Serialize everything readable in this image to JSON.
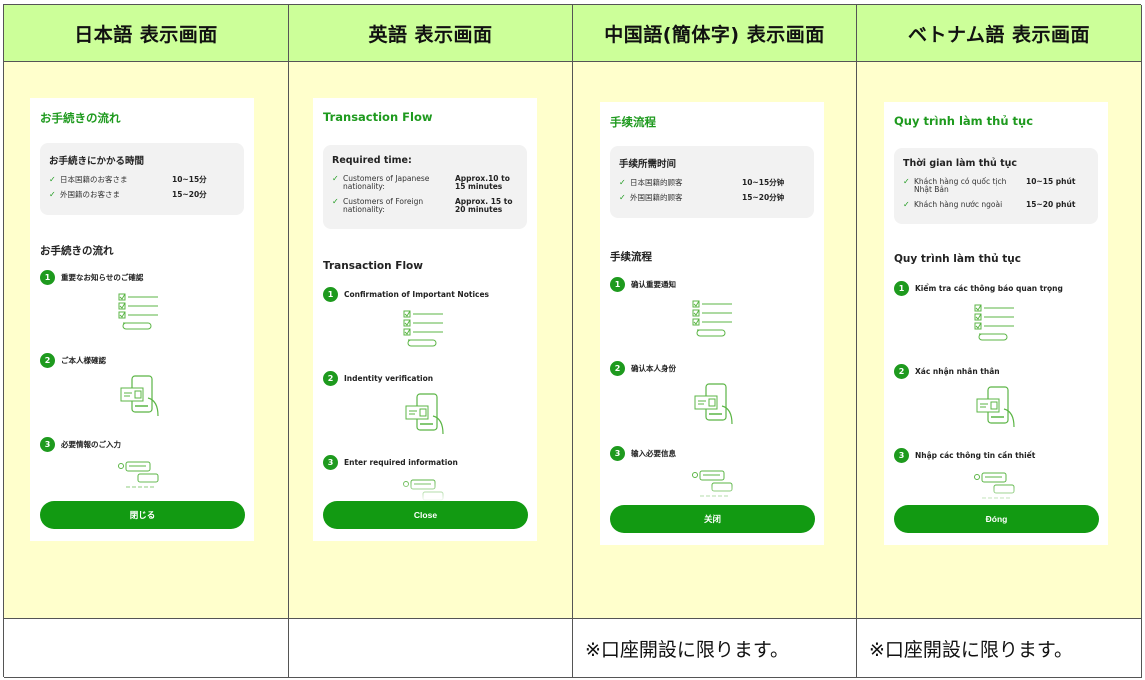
{
  "columns": [
    {
      "header": "日本語 表示画面",
      "footer": "",
      "screen": {
        "title": "お手続きの流れ",
        "required_time_title": "お手続きにかかる時間",
        "rows": [
          {
            "label": "日本国籍のお客さま",
            "value": "10~15分"
          },
          {
            "label": "外国籍のお客さま",
            "value": "15~20分"
          }
        ],
        "flow_title": "お手続きの流れ",
        "steps": [
          {
            "num": "1",
            "label": "重要なお知らせのご確認"
          },
          {
            "num": "2",
            "label": "ご本人様確認"
          },
          {
            "num": "3",
            "label": "必要情報のご入力"
          }
        ],
        "close_label": "閉じる"
      }
    },
    {
      "header": "英語 表示画面",
      "footer": "",
      "screen": {
        "title": "Transaction Flow",
        "required_time_title": "Required time:",
        "rows": [
          {
            "label": "Customers of Japanese nationality:",
            "value": "Approx.10 to 15 minutes"
          },
          {
            "label": "Customers of Foreign nationality:",
            "value": "Approx. 15 to 20 minutes"
          }
        ],
        "flow_title": "Transaction Flow",
        "steps": [
          {
            "num": "1",
            "label": "Confirmation of Important Notices"
          },
          {
            "num": "2",
            "label": "Indentity verification"
          },
          {
            "num": "3",
            "label": "Enter required information"
          }
        ],
        "close_label": "Close"
      }
    },
    {
      "header": "中国語(簡体字) 表示画面",
      "footer": "※口座開設に限ります。",
      "screen": {
        "title": "手续流程",
        "required_time_title": "手续所需时间",
        "rows": [
          {
            "label": "日本国籍的顾客",
            "value": "10~15分钟"
          },
          {
            "label": "外国国籍的顾客",
            "value": "15~20分钟"
          }
        ],
        "flow_title": "手续流程",
        "steps": [
          {
            "num": "1",
            "label": "确认重要通知"
          },
          {
            "num": "2",
            "label": "确认本人身份"
          },
          {
            "num": "3",
            "label": "输入必要信息"
          }
        ],
        "close_label": "关闭"
      }
    },
    {
      "header": "ベトナム語 表示画面",
      "footer": "※口座開設に限ります。",
      "screen": {
        "title": "Quy trình làm thủ tục",
        "required_time_title": "Thời gian làm thủ tục",
        "rows": [
          {
            "label": "Khách hàng có quốc tịch Nhật Bản",
            "value": "10~15 phút"
          },
          {
            "label": "Khách hàng nước ngoài",
            "value": "15~20 phút"
          }
        ],
        "flow_title": "Quy trình làm thủ tục",
        "steps": [
          {
            "num": "1",
            "label": "Kiểm tra các thông báo quan trọng"
          },
          {
            "num": "2",
            "label": "Xác nhận nhân thân"
          },
          {
            "num": "3",
            "label": "Nhập các thông tin cần thiết"
          }
        ],
        "close_label": "Đóng"
      }
    }
  ],
  "icons": {
    "check": "check-icon",
    "step1": "document-checklist-icon",
    "step2": "phone-id-verification-icon",
    "step3": "form-input-icon"
  },
  "colors": {
    "header_bg": "#ccff99",
    "body_bg": "#ffffcc",
    "accent_green": "#1e9a1e",
    "button_green": "#129a12"
  }
}
